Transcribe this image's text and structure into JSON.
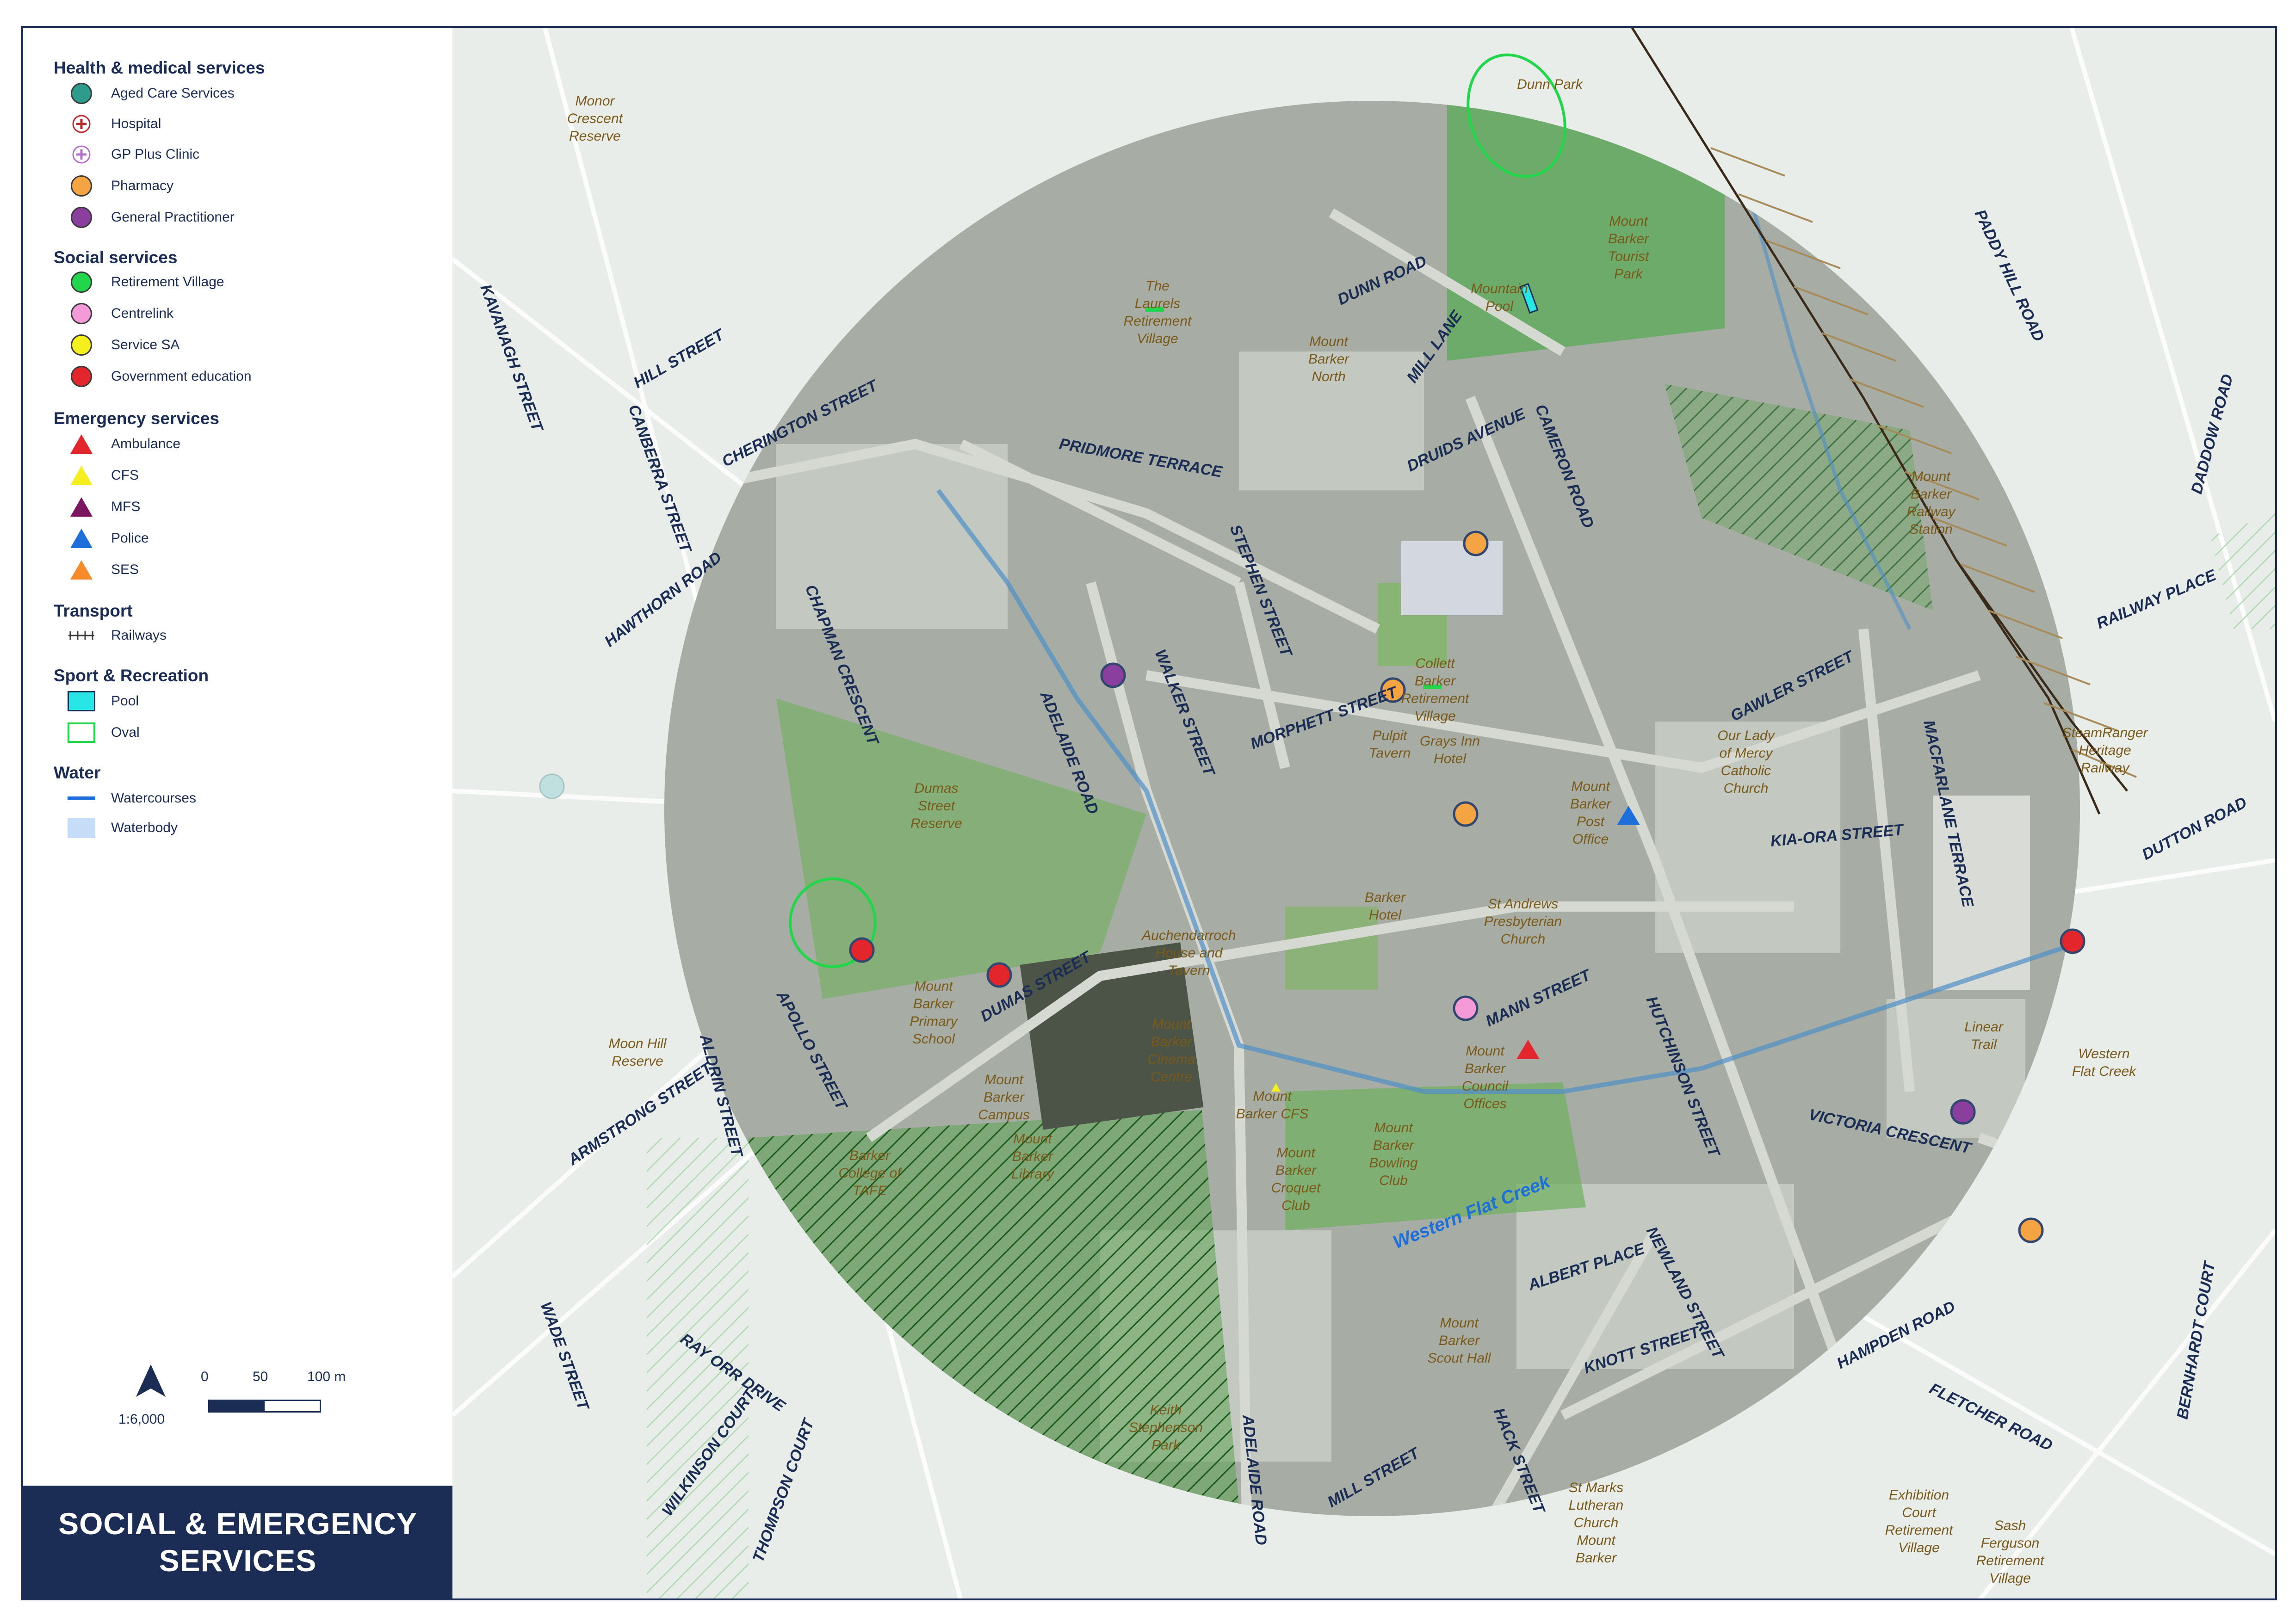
{
  "title": {
    "line1": "SOCIAL & EMERGENCY",
    "line2": "SERVICES"
  },
  "legend": {
    "health": {
      "heading": "Health & medical services",
      "items": [
        {
          "label": "Aged Care Services",
          "icon": "aged-care-dot",
          "color": "#2e9c8c"
        },
        {
          "label": "Hospital",
          "icon": "hospital-cross",
          "color": "#c0272d"
        },
        {
          "label": "GP Plus Clinic",
          "icon": "gp-plus-cross",
          "color": "#b66fd1"
        },
        {
          "label": "Pharmacy",
          "icon": "pharmacy-dot",
          "color": "#f5a443"
        },
        {
          "label": "General Practitioner",
          "icon": "gp-dot",
          "color": "#8a3e9d"
        }
      ]
    },
    "social": {
      "heading": "Social services",
      "items": [
        {
          "label": "Retirement Village",
          "icon": "retirement-dot",
          "color": "#22d64c"
        },
        {
          "label": "Centrelink",
          "icon": "centrelink-dot",
          "color": "#f59ad8"
        },
        {
          "label": "Service SA",
          "icon": "service-sa-dot",
          "color": "#f6ef1e"
        },
        {
          "label": "Government education",
          "icon": "education-dot",
          "color": "#e3262c"
        }
      ]
    },
    "emergency": {
      "heading": "Emergency services",
      "items": [
        {
          "label": "Ambulance",
          "icon": "ambulance-triangle",
          "color": "#e3262c"
        },
        {
          "label": "CFS",
          "icon": "cfs-triangle",
          "color": "#f6ef1e"
        },
        {
          "label": "MFS",
          "icon": "mfs-triangle",
          "color": "#7b1660"
        },
        {
          "label": "Police",
          "icon": "police-triangle",
          "color": "#1e6fd9"
        },
        {
          "label": "SES",
          "icon": "ses-triangle",
          "color": "#f58b2a"
        }
      ]
    },
    "transport": {
      "heading": "Transport",
      "items": [
        {
          "label": "Railways",
          "icon": "railway-line"
        }
      ]
    },
    "sport": {
      "heading": "Sport & Recreation",
      "items": [
        {
          "label": "Pool",
          "icon": "pool-box",
          "color": "#29e6e6"
        },
        {
          "label": "Oval",
          "icon": "oval-box",
          "color": "#22d64c"
        }
      ]
    },
    "water": {
      "heading": "Water",
      "items": [
        {
          "label": "Watercourses",
          "icon": "watercourse-line",
          "color": "#1e6fd9"
        },
        {
          "label": "Waterbody",
          "icon": "waterbody-box",
          "color": "#c6dcf7"
        }
      ]
    }
  },
  "scale": {
    "label_0": "0",
    "label_50": "50",
    "label_100": "100 m",
    "ratio": "1:6,000"
  },
  "streets": [
    "KAVANAGH STREET",
    "HILL STREET",
    "CANBERRA STREET",
    "CHERINGTON STREET",
    "HAWTHORN ROAD",
    "CHAPMAN CRESCENT",
    "PRIDMORE TERRACE",
    "ADELAIDE ROAD",
    "WALKER STREET",
    "STEPHEN STREET",
    "DUNN ROAD",
    "MILL LANE",
    "DRUIDS AVENUE",
    "CAMERON ROAD",
    "MORPHETT STREET",
    "DUMAS STREET",
    "APOLLO STREET",
    "ALDRIN STREET",
    "ARMSTRONG STREET",
    "MANN STREET",
    "HUTCHINSON STREET",
    "GAWLER STREET",
    "KIA-ORA STREET",
    "MACFARLANE TERRACE",
    "VICTORIA CRESCENT",
    "ALBERT PLACE",
    "NEWLAND STREET",
    "KNOTT STREET",
    "HAMPDEN ROAD",
    "HACK STREET",
    "MILL STREET",
    "ADELAIDE ROAD",
    "PADDY HILL ROAD",
    "DADDOW ROAD",
    "RAILWAY PLACE",
    "DUTTON ROAD",
    "FLETCHER ROAD",
    "BERNHARDT COURT",
    "WADE STREET",
    "RAY ORR DRIVE",
    "WILKINSON COURT",
    "THOMPSON COURT"
  ],
  "places": [
    "Monor Crescent Reserve",
    "Dunn Park",
    "The Laurels Retirement Village",
    "Mount Barker North",
    "Mount Barker Tourist Park",
    "Mountain Pool",
    "Mount Barker Railway Station",
    "Dumas Street Reserve",
    "Collett Barker Retirement Village",
    "Pulpit Tavern",
    "Grays Inn Hotel",
    "Mount Barker Post Office",
    "Our Lady of Mercy Catholic Church",
    "SteamRanger Heritage Railway",
    "Barker Hotel",
    "St Andrews Presbyterian Church",
    "Auchendarroch House and Tavern",
    "Mount Barker Cinema Centre",
    "Mount Barker Primary School",
    "Moon Hill Reserve",
    "Mount Barker Campus",
    "Mount Barker Library",
    "Barker College of TAFE",
    "Mount Barker CFS",
    "Mount Barker Council Offices",
    "Mount Barker Bowling Club",
    "Mount Barker Croquet Club",
    "Linear Trail",
    "Western Flat Creek",
    "Mount Barker Scout Hall",
    "Keith Stephenson Park",
    "St Marks Lutheran Church Mount Barker",
    "Exhibition Court Retirement Village",
    "Sash Ferguson Retirement Village"
  ],
  "creek_label": "Western Flat Creek"
}
